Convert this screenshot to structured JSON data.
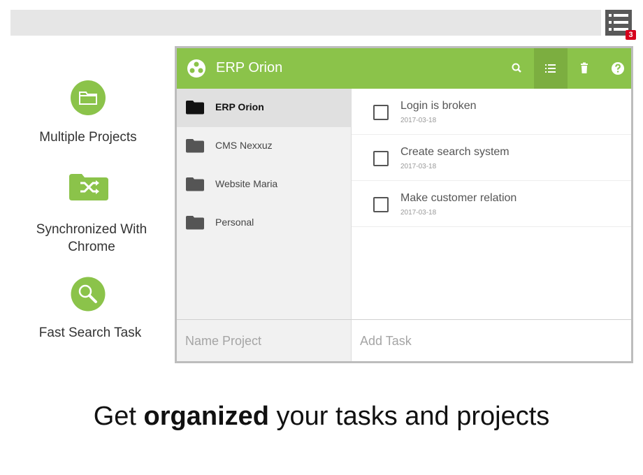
{
  "browser": {
    "extension_badge": "3",
    "extension_icon": "list-icon"
  },
  "features": [
    {
      "label": "Multiple Projects",
      "icon": "folder-icon"
    },
    {
      "label_line1": "Synchronized With",
      "label_line2": "Chrome",
      "icon": "shuffle-folder-icon"
    },
    {
      "label": "Fast Search Task",
      "icon": "search-icon"
    }
  ],
  "app": {
    "title": "ERP Orion",
    "header_icons": [
      "search-icon",
      "list-icon",
      "trash-icon",
      "help-icon"
    ],
    "projects": [
      {
        "name": "ERP Orion",
        "active": true
      },
      {
        "name": "CMS Nexxuz",
        "active": false
      },
      {
        "name": "Website Maria",
        "active": false
      },
      {
        "name": "Personal",
        "active": false
      }
    ],
    "tasks": [
      {
        "title": "Login is broken",
        "date": "2017-03-18"
      },
      {
        "title": "Create search system",
        "date": "2017-03-18"
      },
      {
        "title": "Make customer relation",
        "date": "2017-03-18"
      }
    ],
    "name_project_placeholder": "Name Project",
    "add_task_placeholder": "Add Task"
  },
  "tagline": {
    "pre": "Get ",
    "bold": "organized",
    "post": " your tasks and projects"
  },
  "colors": {
    "accent": "#8bc34a",
    "accent_dark": "#7cae40",
    "badge": "#d6001c"
  }
}
